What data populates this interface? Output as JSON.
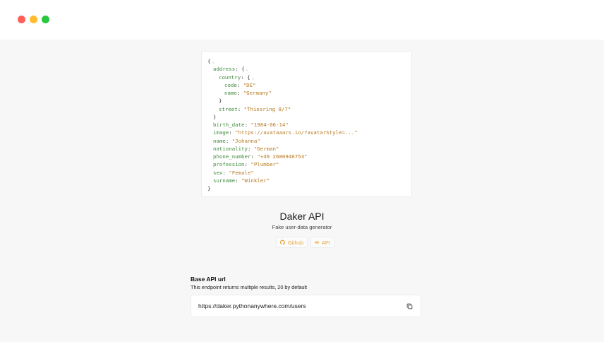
{
  "window": {
    "controls": [
      "close",
      "minimize",
      "maximize"
    ]
  },
  "json_preview": {
    "lines": [
      {
        "indent": 0,
        "key": "",
        "value": "",
        "open": "{",
        "collapsible": true
      },
      {
        "indent": 1,
        "key": "address",
        "value": "",
        "open": "{",
        "collapsible": true
      },
      {
        "indent": 2,
        "key": "country",
        "value": "",
        "open": "{",
        "collapsible": true
      },
      {
        "indent": 3,
        "key": "code",
        "value": "\"DE\"",
        "open": "",
        "collapsible": false
      },
      {
        "indent": 3,
        "key": "name",
        "value": "\"Germany\"",
        "open": "",
        "collapsible": false
      },
      {
        "indent": 2,
        "key": "",
        "value": "",
        "open": "}",
        "collapsible": false
      },
      {
        "indent": 2,
        "key": "street",
        "value": "\"Thiesring 8/7\"",
        "open": "",
        "collapsible": false
      },
      {
        "indent": 1,
        "key": "",
        "value": "",
        "open": "}",
        "collapsible": false
      },
      {
        "indent": 1,
        "key": "birth_date",
        "value": "\"1984-06-14\"",
        "open": "",
        "collapsible": false
      },
      {
        "indent": 1,
        "key": "image",
        "value": "\"https://avataaars.io/?avatarStyle=...\"",
        "open": "",
        "collapsible": false
      },
      {
        "indent": 1,
        "key": "name",
        "value": "\"Johanna\"",
        "open": "",
        "collapsible": false
      },
      {
        "indent": 1,
        "key": "nationality",
        "value": "\"German\"",
        "open": "",
        "collapsible": false
      },
      {
        "indent": 1,
        "key": "phone_number",
        "value": "\"+49 2680946753\"",
        "open": "",
        "collapsible": false
      },
      {
        "indent": 1,
        "key": "profession",
        "value": "\"Plumber\"",
        "open": "",
        "collapsible": false
      },
      {
        "indent": 1,
        "key": "sex",
        "value": "\"Female\"",
        "open": "",
        "collapsible": false
      },
      {
        "indent": 1,
        "key": "surname",
        "value": "\"Winkler\"",
        "open": "",
        "collapsible": false
      },
      {
        "indent": 0,
        "key": "",
        "value": "",
        "open": "}",
        "collapsible": false
      }
    ]
  },
  "hero": {
    "title": "Daker API",
    "subtitle": "Fake user-data generator",
    "github_label": "Github",
    "api_label": "API"
  },
  "base_url": {
    "title": "Base API url",
    "description": "This endpoint returns multiple results, 20 by default",
    "url": "https://daker.pythonanywhere.com/users",
    "copy_icon": "copy-icon"
  },
  "colors": {
    "accent": "#e8a53a",
    "json_key": "#3d8a3a",
    "json_string": "#b87a22",
    "close": "#fe5f57",
    "minimize": "#febc2e",
    "maximize": "#28c840"
  }
}
